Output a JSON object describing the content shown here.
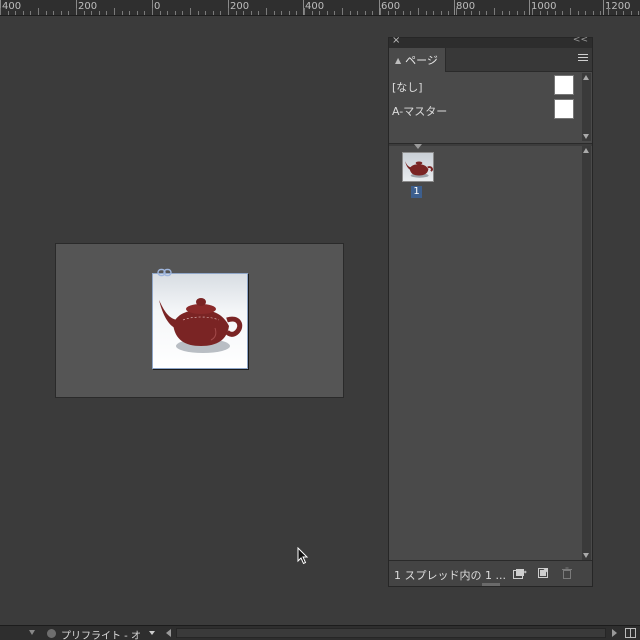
{
  "ruler": {
    "labels": [
      "400",
      "200",
      "0",
      "200",
      "400",
      "600",
      "800",
      "1000",
      "1200"
    ]
  },
  "pages_panel": {
    "close_glyph": "×",
    "collapse_glyph": "<<",
    "tab_label": "ページ",
    "masters": [
      {
        "label": "[なし]"
      },
      {
        "label": "A-マスター"
      }
    ],
    "page_number": "1",
    "footer_text": "1 スプレッド内の 1 ..."
  },
  "statusbar": {
    "preflight_label": "プリフライト - オ"
  },
  "colors": {
    "accent": "#3d5f8e",
    "teapot": "#7a2424",
    "frame_border": "#8fa6c8"
  },
  "icons": [
    "link-icon",
    "panel-menu-icon",
    "new-spread-icon",
    "new-page-icon",
    "trash-icon",
    "cursor-icon",
    "split-view-icon"
  ]
}
